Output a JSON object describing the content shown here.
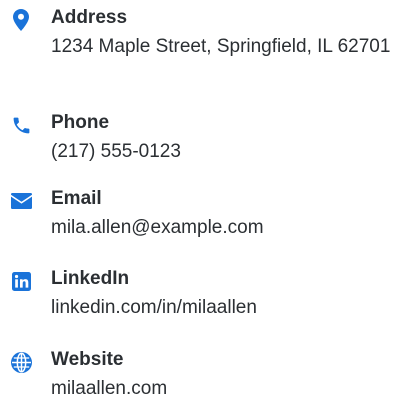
{
  "accent_color": "#1a73d9",
  "contacts": [
    {
      "icon": "map-pin-icon",
      "label": "Address",
      "value": "1234 Maple Street, Springfield, IL 62701"
    },
    {
      "icon": "phone-icon",
      "label": "Phone",
      "value": "(217) 555-0123"
    },
    {
      "icon": "envelope-icon",
      "label": "Email",
      "value": "mila.allen@example.com"
    },
    {
      "icon": "linkedin-icon",
      "label": "LinkedIn",
      "value": "linkedin.com/in/milaallen"
    },
    {
      "icon": "globe-icon",
      "label": "Website",
      "value": "milaallen.com"
    }
  ]
}
